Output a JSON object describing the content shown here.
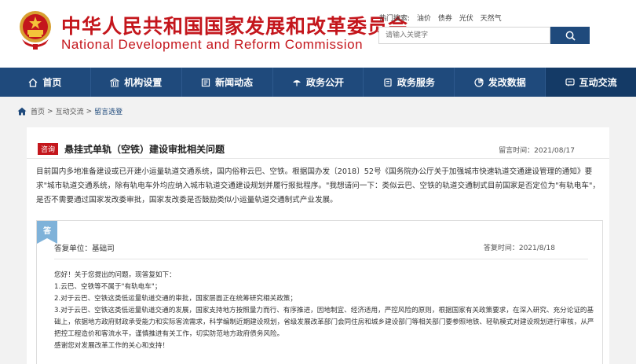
{
  "header": {
    "title_cn": "中华人民共和国国家发展和改革委员会",
    "title_en": "National Development and Reform Commission",
    "hot_search_label": "热门搜索:",
    "hot_terms": [
      "油价",
      "债券",
      "光伏",
      "天然气"
    ],
    "search_placeholder": "请输入关键字"
  },
  "nav": {
    "items": [
      {
        "label": "首页",
        "icon": "home-icon"
      },
      {
        "label": "机构设置",
        "icon": "institution-icon"
      },
      {
        "label": "新闻动态",
        "icon": "news-icon"
      },
      {
        "label": "政务公开",
        "icon": "umbrella-icon"
      },
      {
        "label": "政务服务",
        "icon": "service-icon"
      },
      {
        "label": "发改数据",
        "icon": "chart-icon"
      },
      {
        "label": "互动交流",
        "icon": "chat-icon"
      }
    ],
    "active_index": 6
  },
  "breadcrumb": {
    "items": [
      "首页",
      "互动交流",
      "留言选登"
    ],
    "separator": ">"
  },
  "question": {
    "badge": "咨询",
    "title": "悬挂式单轨（空铁）建设审批相关问题",
    "date_label": "留言时间：2021/08/17",
    "body": "目前国内多地准备建设或已开建小运量轨道交通系统，国内俗称云巴、空铁。根据国办发〔2018〕52号《国务院办公厅关于加强城市快速轨道交通建设管理的通知》要求\"城市轨道交通系统，除有轨电车外均应纳入城市轨道交通建设规划并履行报批程序。\"我想请问一下：类似云巴、空铁的轨道交通制式目前国家是否定位为\"有轨电车\"，是否不需要通过国家发改委审批，国家发改委是否鼓励类似小运量轨道交通制式产业发展。"
  },
  "answer": {
    "tag": "答",
    "unit_label": "答复单位：基础司",
    "date_label": "答复时间：2021/8/18",
    "lines": [
      "您好！关于您提出的问题，现答复如下：",
      "1.云巴、空铁等不属于\"有轨电车\"；",
      "2.对于云巴、空铁这类低运量轨道交通的审批，国家层面正在统筹研究相关政策；",
      "3.对于云巴、空铁这类低运量轨道交通的发展，国家支持地方按照量力而行、有序推进，因地制宜、经济适用，严控风险的原则，根据国家有关政策要求，在深入研究、充分论证的基础上，依据地方政府财政承受能力和实际客流需求，科学编制近期建设规划，省级发展改革部门会同住房和城乡建设部门等相关部门要参照地铁、轻轨模式对建设规划进行审核，从严把控工程造价和客流水平，谨慎推进有关工作，切实防范地方政府债务风险。",
      "感谢您对发展改革工作的关心和支持！"
    ]
  },
  "colors": {
    "brand_red": "#c4161c",
    "nav_blue": "#1f4a7c",
    "answer_tag_blue": "#7fb2d9"
  }
}
